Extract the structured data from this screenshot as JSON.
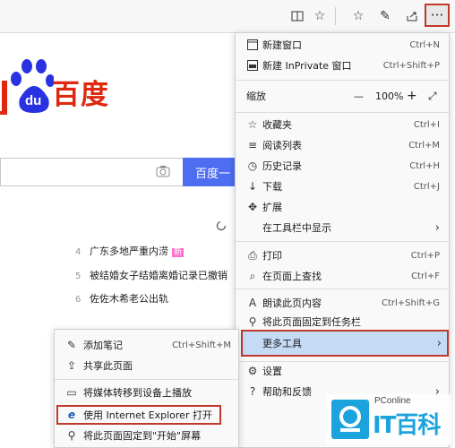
{
  "toolbar": {
    "icons": [
      "reading-view-icon",
      "favorite-star-icon",
      "favorites-list-icon",
      "pen-icon",
      "share-icon",
      "more-icon"
    ],
    "more_glyph": "···"
  },
  "page": {
    "logo_text": "百度",
    "logo_du": "du",
    "search_button": "百度一",
    "hot_items": [
      {
        "num": "4",
        "text": "广东多地严重内涝",
        "badge": "新"
      },
      {
        "num": "5",
        "text": "被结婚女子结婚离婚记录已撤销",
        "badge": ""
      },
      {
        "num": "6",
        "text": "佐佐木希老公出轨",
        "badge": ""
      }
    ]
  },
  "menu": {
    "new_window": {
      "label": "新建窗口",
      "shortcut": "Ctrl+N"
    },
    "new_inprivate": {
      "label": "新建 InPrivate 窗口",
      "shortcut": "Ctrl+Shift+P"
    },
    "zoom": {
      "label": "缩放",
      "minus": "—",
      "value": "100%",
      "plus": "+",
      "expand": "⤢"
    },
    "favorites": {
      "label": "收藏夹",
      "shortcut": "Ctrl+I"
    },
    "reading_list": {
      "label": "阅读列表",
      "shortcut": "Ctrl+M"
    },
    "history": {
      "label": "历史记录",
      "shortcut": "Ctrl+H"
    },
    "downloads": {
      "label": "下载",
      "shortcut": "Ctrl+J"
    },
    "extensions": {
      "label": "扩展"
    },
    "show_in_toolbar": {
      "label": "在工具栏中显示"
    },
    "print": {
      "label": "打印",
      "shortcut": "Ctrl+P"
    },
    "find": {
      "label": "在页面上查找",
      "shortcut": "Ctrl+F"
    },
    "read_aloud": {
      "label": "朗读此页内容",
      "shortcut": "Ctrl+Shift+G"
    },
    "pin_taskbar": {
      "label": "将此页面固定到任务栏"
    },
    "more_tools": {
      "label": "更多工具"
    },
    "settings": {
      "label": "设置"
    },
    "help": {
      "label": "帮助和反馈"
    }
  },
  "submenu": {
    "add_notes": {
      "label": "添加笔记",
      "shortcut": "Ctrl+Shift+M"
    },
    "share_page": {
      "label": "共享此页面"
    },
    "cast": {
      "label": "将媒体转移到设备上播放"
    },
    "open_ie": {
      "label": "使用 Internet Explorer 打开"
    },
    "pin_start": {
      "label": "将此页面固定到\"开始\"屏幕"
    }
  },
  "watermark": {
    "brand": "PConline",
    "name": "IT百科"
  },
  "colors": {
    "accent": "#4e6ef2",
    "baidu_red": "#de2910",
    "highlight": "#c5daf4",
    "annotation_red": "#c0392b",
    "watermark_blue": "#1aa3dd"
  }
}
